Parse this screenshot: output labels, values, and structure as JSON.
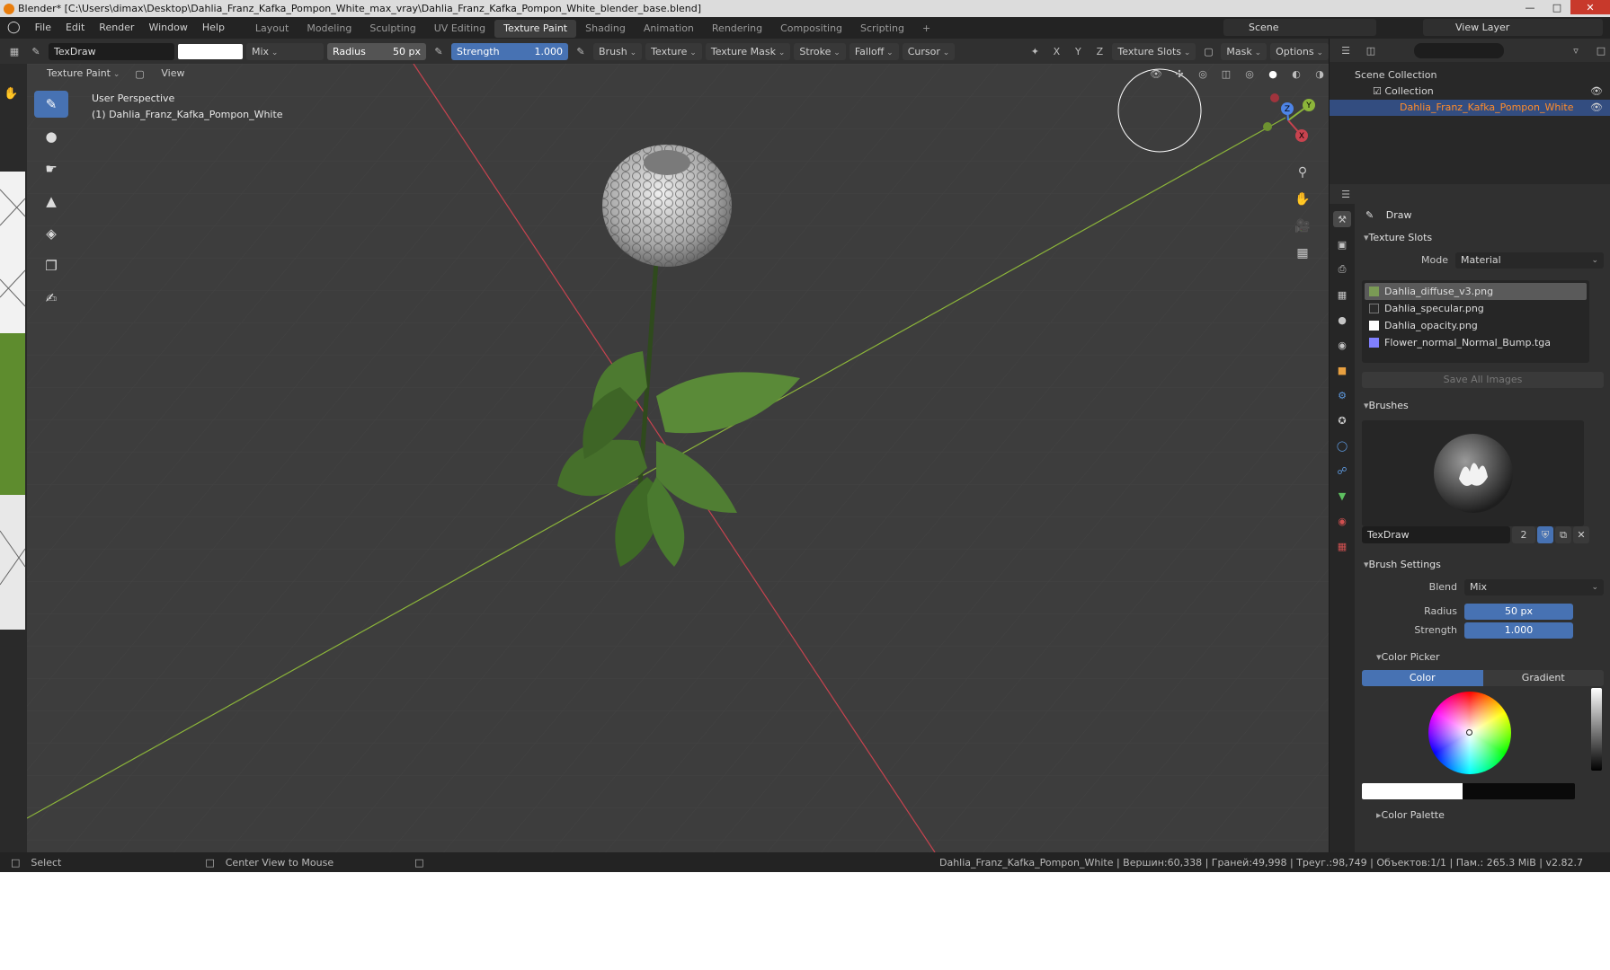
{
  "window": {
    "title": "Blender* [C:\\Users\\dimax\\Desktop\\Dahlia_Franz_Kafka_Pompon_White_max_vray\\Dahlia_Franz_Kafka_Pompon_White_blender_base.blend]"
  },
  "menu": {
    "items": [
      "File",
      "Edit",
      "Render",
      "Window",
      "Help"
    ]
  },
  "workspaces": {
    "tabs": [
      "Layout",
      "Modeling",
      "Sculpting",
      "UV Editing",
      "Texture Paint",
      "Shading",
      "Animation",
      "Rendering",
      "Compositing",
      "Scripting"
    ],
    "active_index": 4,
    "add_label": "+"
  },
  "scene": {
    "name": "Scene",
    "view_layer": "View Layer"
  },
  "tool_header": {
    "brush_name": "TexDraw",
    "blend": "Mix",
    "radius_label": "Radius",
    "radius_value": "50 px",
    "strength_label": "Strength",
    "strength_value": "1.000",
    "menus": [
      "Brush",
      "Texture",
      "Texture Mask",
      "Stroke",
      "Falloff",
      "Cursor"
    ],
    "axes": [
      "X",
      "Y",
      "Z"
    ],
    "texture_slots": "Texture Slots",
    "mask": "Mask",
    "options": "Options"
  },
  "view_header": {
    "mode": "Texture Paint",
    "view": "View"
  },
  "viewport": {
    "perspective": "User Perspective",
    "object": "(1) Dahlia_Franz_Kafka_Pompon_White",
    "gizmo": {
      "x": "X",
      "y": "Y",
      "z": "Z"
    }
  },
  "outliner": {
    "scene_collection": "Scene Collection",
    "collection": "Collection",
    "object": "Dahlia_Franz_Kafka_Pompon_White"
  },
  "properties": {
    "tool_name": "Draw",
    "texture_slots": {
      "title": "Texture Slots",
      "mode_label": "Mode",
      "mode_value": "Material",
      "slots": [
        {
          "name": "Dahlia_diffuse_v3.png",
          "color": "#7a9a55"
        },
        {
          "name": "Dahlia_specular.png",
          "color": "#2a2a2a"
        },
        {
          "name": "Dahlia_opacity.png",
          "color": "#ffffff"
        },
        {
          "name": "Flower_normal_Normal_Bump.tga",
          "color": "#8080ff"
        }
      ],
      "save_all": "Save All Images"
    },
    "brushes": {
      "title": "Brushes",
      "brush_name": "TexDraw",
      "users": "2"
    },
    "brush_settings": {
      "title": "Brush Settings",
      "blend_label": "Blend",
      "blend_value": "Mix",
      "radius_label": "Radius",
      "radius_value": "50 px",
      "strength_label": "Strength",
      "strength_value": "1.000"
    },
    "color_picker": {
      "title": "Color Picker",
      "tab_color": "Color",
      "tab_gradient": "Gradient"
    },
    "color_palette": {
      "title": "Color Palette"
    }
  },
  "status_bar": {
    "select": "Select",
    "center_view": "Center View to Mouse",
    "stats": "Dahlia_Franz_Kafka_Pompon_White | Вершин:60,338 | Граней:49,998 | Треуг.:98,749 | Объектов:1/1 | Пам.: 265.3 MiB | v2.82.7"
  },
  "colors": {
    "accent": "#4772b3",
    "x_axis": "#c8434f",
    "y_axis": "#8cb53a",
    "z_axis": "#4d84e8",
    "selected_object": "#ff8c2a"
  }
}
